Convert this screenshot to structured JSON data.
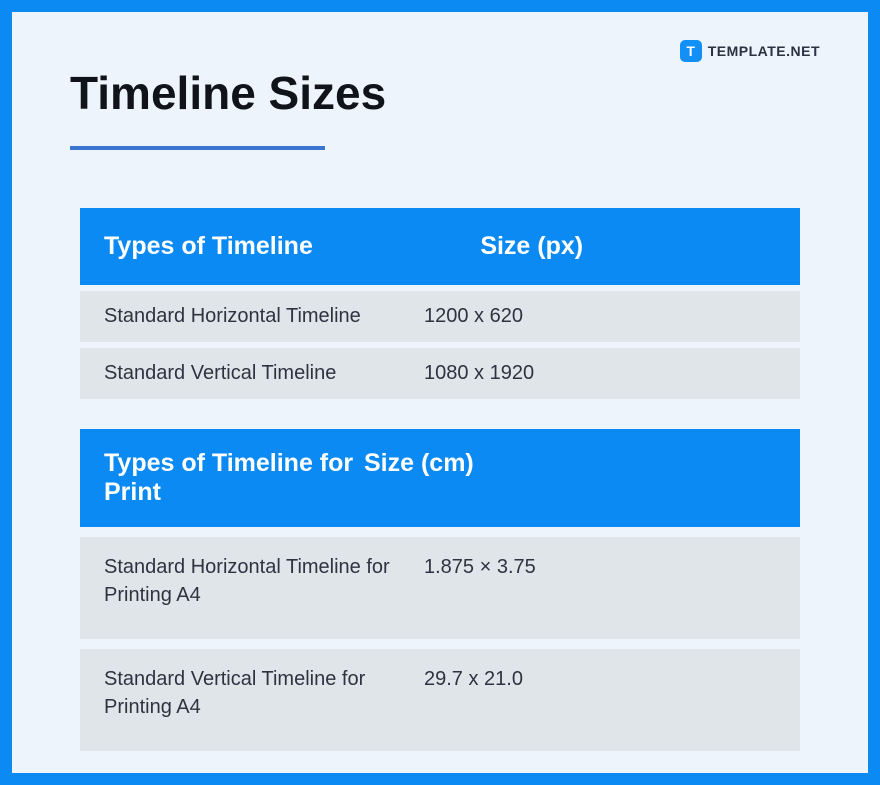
{
  "brand": {
    "icon_letter": "T",
    "text": "TEMPLATE.NET"
  },
  "title": "Timeline Sizes",
  "tables": [
    {
      "headers": {
        "type": "Types of Timeline",
        "size": "Size (px)"
      },
      "rows": [
        {
          "type": "Standard Horizontal Timeline",
          "size": "1200 x 620"
        },
        {
          "type": "Standard Vertical Timeline",
          "size": "1080 x 1920"
        }
      ]
    },
    {
      "headers": {
        "type": "Types of Timeline for Print",
        "size": "Size (cm)"
      },
      "rows": [
        {
          "type": "Standard Horizontal Timeline for Printing A4",
          "size": "1.875 × 3.75"
        },
        {
          "type": "Standard Vertical Timeline for Printing A4",
          "size": "29.7 x 21.0"
        }
      ]
    }
  ]
}
